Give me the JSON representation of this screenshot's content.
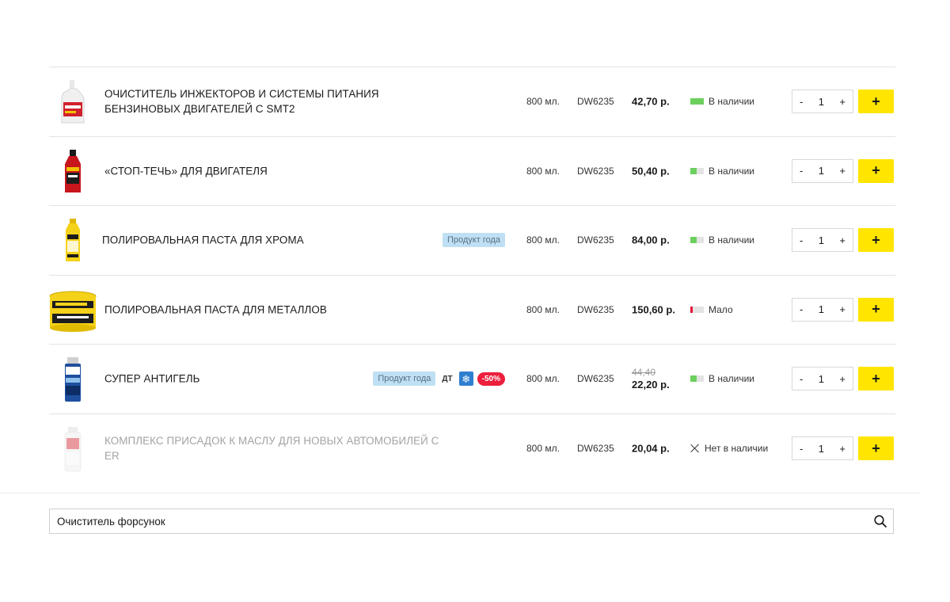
{
  "products": [
    {
      "name": "Очиститель инжекторов и системы питания бензиновых двигателей с SMT2",
      "volume": "800 мл.",
      "code": "DW6235",
      "price": "42,70 р.",
      "price_old": "",
      "stock_text": "В наличии",
      "stock_level": 1.0,
      "stock_color": "#6cd05f",
      "tags": {
        "year": "",
        "dt": "",
        "snow": false,
        "sale": ""
      },
      "qty": "1",
      "available": true,
      "image": "injector-cleaner-bottle"
    },
    {
      "name": "«Стоп-течь» для двигателя",
      "volume": "800 мл.",
      "code": "DW6235",
      "price": "50,40 р.",
      "price_old": "",
      "stock_text": "В наличии",
      "stock_level": 0.45,
      "stock_color": "#6cd05f",
      "tags": {
        "year": "",
        "dt": "",
        "snow": false,
        "sale": ""
      },
      "qty": "1",
      "available": true,
      "image": "stop-leak-bottle"
    },
    {
      "name": "Полировальная паста для хрома",
      "volume": "800 мл.",
      "code": "DW6235",
      "price": "84,00 р.",
      "price_old": "",
      "stock_text": "В наличии",
      "stock_level": 0.45,
      "stock_color": "#6cd05f",
      "tags": {
        "year": "Продукт года",
        "dt": "",
        "snow": false,
        "sale": ""
      },
      "qty": "1",
      "available": true,
      "image": "chrome-polish-bottle"
    },
    {
      "name": "Полировальная паста для металлов",
      "volume": "800 мл.",
      "code": "DW6235",
      "price": "150,60 р.",
      "price_old": "",
      "stock_text": "Мало",
      "stock_level": 0.15,
      "stock_color": "#e8173c",
      "tags": {
        "year": "",
        "dt": "",
        "snow": false,
        "sale": ""
      },
      "qty": "1",
      "available": true,
      "image": "metal-polish-jar"
    },
    {
      "name": "Супер антигель",
      "volume": "800 мл.",
      "code": "DW6235",
      "price": "22,20 р.",
      "price_old": "44,40",
      "stock_text": "В наличии",
      "stock_level": 0.45,
      "stock_color": "#6cd05f",
      "tags": {
        "year": "Продукт года",
        "dt": "ДТ",
        "snow": true,
        "snow_glyph": "❄",
        "sale": "-50%"
      },
      "qty": "1",
      "available": true,
      "image": "antigel-can"
    },
    {
      "name": "Комплекс присадок к маслу для новых автомобилей с ER",
      "volume": "800 мл.",
      "code": "DW6235",
      "price": "20,04 р.",
      "price_old": "",
      "stock_text": "Нет в наличии",
      "stock_level": 0,
      "stock_color": "",
      "tags": {
        "year": "",
        "dt": "",
        "snow": false,
        "sale": ""
      },
      "qty": "1",
      "available": false,
      "image": "oil-additive-bottle"
    }
  ],
  "controls": {
    "minus": "-",
    "plus": "+",
    "add": "+"
  },
  "search": {
    "value": "Очиститель форсунок",
    "placeholder": ""
  },
  "colors": {
    "accent": "#ffe500",
    "sale": "#ec1f3c",
    "year_tag": "#bfe0f4",
    "snow_tag": "#2f7fd1"
  }
}
